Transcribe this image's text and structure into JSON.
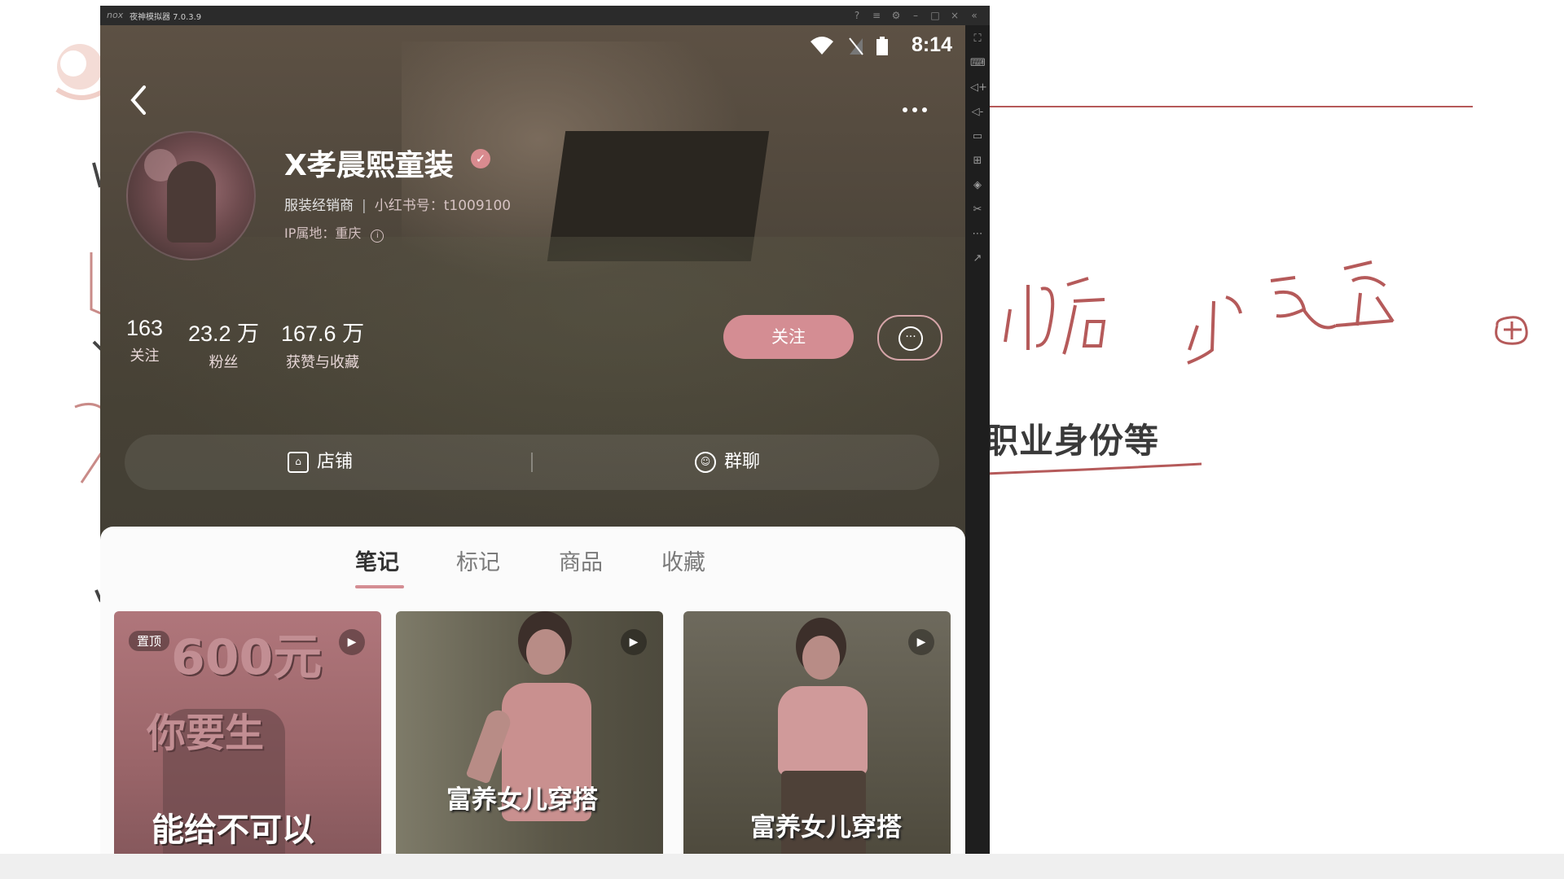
{
  "emulator": {
    "logo": "nox",
    "title": "夜神模拟器 7.0.3.9"
  },
  "status_bar": {
    "time": "8:14"
  },
  "profile": {
    "name": "X孝晨熙童装",
    "category": "服装经销商",
    "id_label": "小红书号：t1009100",
    "ip_location": "IP属地：重庆",
    "stats": [
      {
        "value": "163",
        "label": "关注"
      },
      {
        "value": "23.2 万",
        "label": "粉丝"
      },
      {
        "value": "167.6 万",
        "label": "获赞与收藏"
      }
    ],
    "follow_label": "关注",
    "actions": {
      "shop_label": "店铺",
      "group_label": "群聊"
    }
  },
  "tabs": [
    "笔记",
    "标记",
    "商品",
    "收藏"
  ],
  "active_tab": "笔记",
  "notes": [
    {
      "pin_label": "置顶",
      "big_text": "600元",
      "mid_text": "你要生",
      "bottom_text": "能给不可以"
    },
    {
      "caption": "富养女儿穿搭"
    },
    {
      "caption": "富养女儿穿搭"
    }
  ],
  "whiteboard": {
    "text": "职业身份等"
  },
  "colors": {
    "accent": "#d48d93",
    "phone_bg": "#4e463b",
    "panel_bg": "#fbfbfb"
  },
  "icons": [
    "back-arrow-icon",
    "more-dots-icon",
    "verified-icon",
    "info-icon",
    "chat-bubble-icon",
    "shop-icon",
    "group-icon",
    "play-icon",
    "wifi-icon",
    "signal-icon",
    "battery-icon"
  ]
}
